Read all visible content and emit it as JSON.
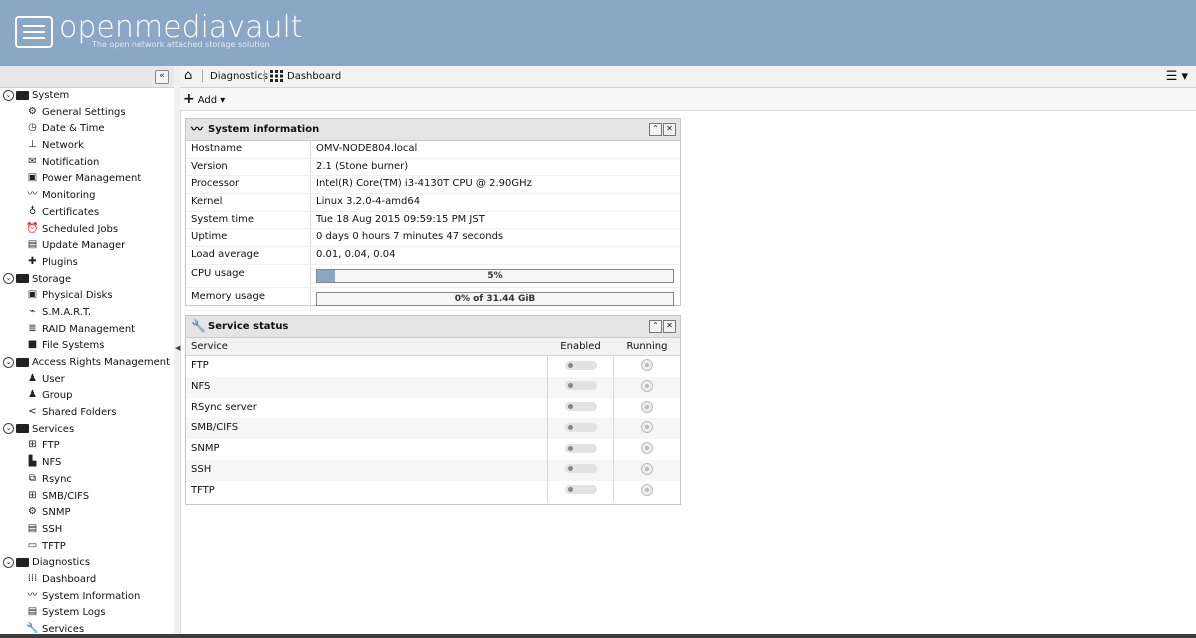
{
  "header": {
    "logo_text": "openmediavault",
    "tagline": "The open network attached storage solution"
  },
  "nav": {
    "collapse_icon": "chevron-double-left-icon",
    "groups": [
      {
        "label": "System",
        "items": [
          "General Settings",
          "Date & Time",
          "Network",
          "Notification",
          "Power Management",
          "Monitoring",
          "Certificates",
          "Scheduled Jobs",
          "Update Manager",
          "Plugins"
        ]
      },
      {
        "label": "Storage",
        "items": [
          "Physical Disks",
          "S.M.A.R.T.",
          "RAID Management",
          "File Systems"
        ]
      },
      {
        "label": "Access Rights Management",
        "items": [
          "User",
          "Group",
          "Shared Folders"
        ]
      },
      {
        "label": "Services",
        "items": [
          "FTP",
          "NFS",
          "Rsync",
          "SMB/CIFS",
          "SNMP",
          "SSH",
          "TFTP"
        ]
      },
      {
        "label": "Diagnostics",
        "items": [
          "Dashboard",
          "System Information",
          "System Logs",
          "Services"
        ]
      }
    ]
  },
  "breadcrumb": {
    "item1": "Diagnostics",
    "item2": "Dashboard"
  },
  "toolbar": {
    "add_label": "Add"
  },
  "sysinfo": {
    "title": "System information",
    "rows": [
      {
        "k": "Hostname",
        "v": "OMV-NODE804.local"
      },
      {
        "k": "Version",
        "v": "2.1 (Stone burner)"
      },
      {
        "k": "Processor",
        "v": "Intel(R) Core(TM) i3-4130T CPU @ 2.90GHz"
      },
      {
        "k": "Kernel",
        "v": "Linux 3.2.0-4-amd64"
      },
      {
        "k": "System time",
        "v": "Tue 18 Aug 2015 09:59:15 PM JST"
      },
      {
        "k": "Uptime",
        "v": "0 days 0 hours 7 minutes 47 seconds"
      },
      {
        "k": "Load average",
        "v": "0.01, 0.04, 0.04"
      }
    ],
    "cpu_label": "CPU usage",
    "cpu_text": "5%",
    "cpu_fraction": 0.05,
    "mem_label": "Memory usage",
    "mem_text": "0% of 31.44 GiB",
    "mem_fraction": 0.0
  },
  "services": {
    "title": "Service status",
    "col_service": "Service",
    "col_enabled": "Enabled",
    "col_running": "Running",
    "rows": [
      "FTP",
      "NFS",
      "RSync server",
      "SMB/CIFS",
      "SNMP",
      "SSH",
      "TFTP"
    ]
  }
}
